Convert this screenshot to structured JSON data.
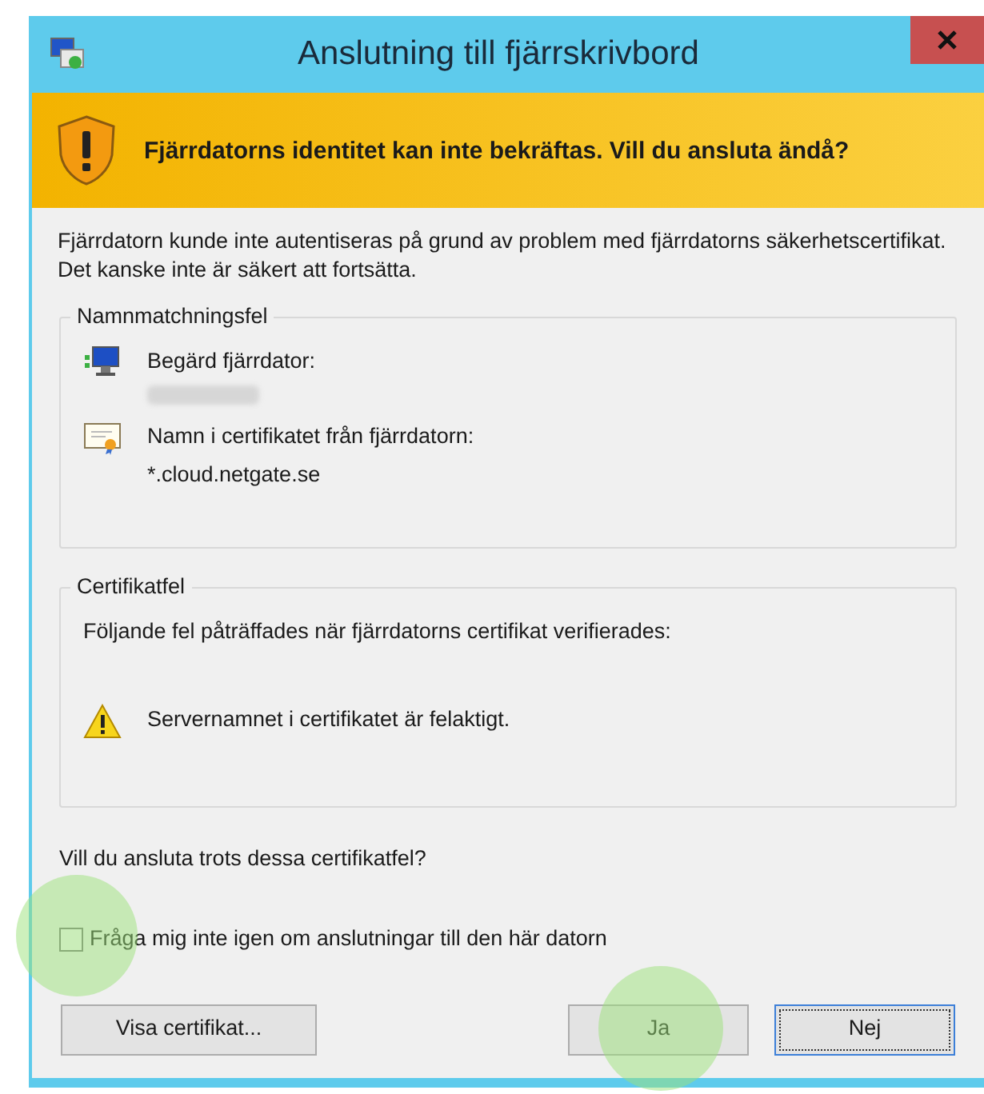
{
  "window": {
    "title": "Anslutning till fjärrskrivbord"
  },
  "banner": {
    "text": "Fjärrdatorns identitet kan inte bekräftas. Vill du ansluta ändå?"
  },
  "description": "Fjärrdatorn kunde inte autentiseras på grund av problem med fjärrdatorns säkerhetscertifikat. Det kanske inte är säkert att fortsätta.",
  "name_mismatch": {
    "title": "Namnmatchningsfel",
    "items": [
      {
        "kind": "computer",
        "label": "Begärd fjärrdator:",
        "redacted": true
      },
      {
        "kind": "certificate",
        "label": "Namn i certifikatet från fjärrdatorn:",
        "value": "*.cloud.netgate.se",
        "redacted": false
      }
    ]
  },
  "certificate_errors": {
    "title": "Certifikatfel",
    "intro": "Följande fel påträffades när fjärrdatorns certifikat verifierades:",
    "errors": [
      "Servernamnet i certifikatet är felaktigt."
    ]
  },
  "question": "Vill du ansluta trots dessa certifikatfel?",
  "dont_ask": {
    "label": "Fråga mig inte igen om anslutningar till den här datorn",
    "checked": false
  },
  "buttons": [
    {
      "label": "Visa certifikat...",
      "focused": false
    },
    {
      "label": "Ja",
      "focused": false
    },
    {
      "label": "Nej",
      "focused": true
    }
  ]
}
